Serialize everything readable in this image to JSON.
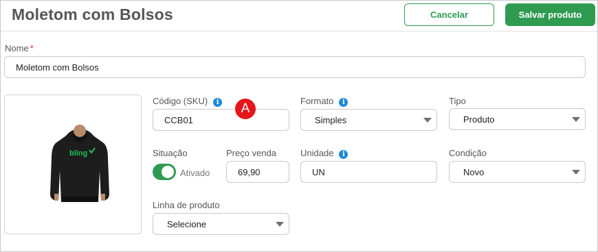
{
  "header": {
    "title": "Moletom com Bolsos",
    "cancel_label": "Cancelar",
    "save_label": "Salvar produto"
  },
  "form": {
    "name": {
      "label": "Nome",
      "required_mark": "*",
      "value": "Moletom com Bolsos"
    },
    "sku": {
      "label": "Código (SKU)",
      "value": "CCB01",
      "info_icon": "info-icon"
    },
    "format": {
      "label": "Formato",
      "value": "Simples",
      "info_icon": "info-icon"
    },
    "type": {
      "label": "Tipo",
      "value": "Produto"
    },
    "status": {
      "label": "Situação",
      "toggle_label": "Ativado",
      "on": true
    },
    "price": {
      "label": "Preço venda",
      "value": "69,90"
    },
    "unit": {
      "label": "Unidade",
      "value": "UN",
      "info_icon": "info-icon"
    },
    "condition": {
      "label": "Condição",
      "value": "Novo"
    },
    "product_line": {
      "label": "Linha de produto",
      "value": "Selecione"
    }
  },
  "annotation": {
    "marker": "A"
  },
  "product_image": {
    "logo_text": "bling"
  },
  "colors": {
    "brand_green": "#2f9b51",
    "info_blue": "#1e88d8",
    "marker_red": "#e4161b",
    "required_red": "#e0272b"
  }
}
